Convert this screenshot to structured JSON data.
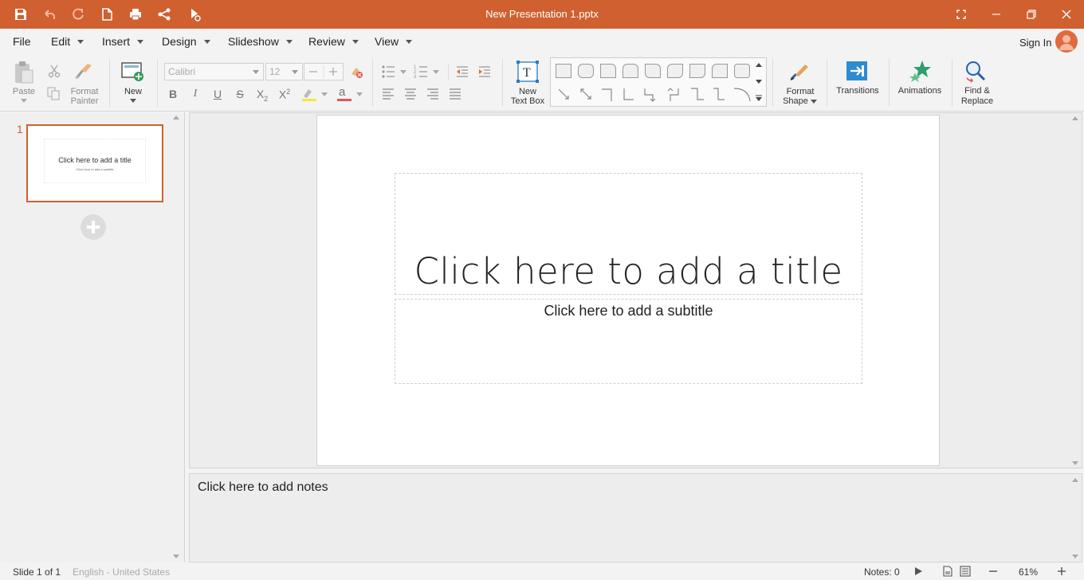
{
  "titlebar": {
    "document_title": "New Presentation 1.pptx",
    "quick_access": [
      "save-icon",
      "undo-icon",
      "redo-icon",
      "new-document-icon",
      "print-icon",
      "share-icon",
      "slideshow-from-start-icon"
    ],
    "window_controls": [
      "fullscreen-icon",
      "minimize-icon",
      "restore-icon",
      "close-icon"
    ]
  },
  "menu": {
    "file": "File",
    "edit": "Edit",
    "insert": "Insert",
    "design": "Design",
    "slideshow": "Slideshow",
    "review": "Review",
    "view": "View",
    "sign_in": "Sign In"
  },
  "ribbon": {
    "paste": "Paste",
    "format_painter_line1": "Format",
    "format_painter_line2": "Painter",
    "new": "New",
    "font_name": "Calibri",
    "font_size": "12",
    "new_text_box_line1": "New",
    "new_text_box_line2": "Text Box",
    "format_shape_line1": "Format",
    "format_shape_line2": "Shape",
    "transitions": "Transitions",
    "animations": "Animations",
    "find_replace_line1": "Find &",
    "find_replace_line2": "Replace"
  },
  "slides_panel": {
    "slide_number": "1",
    "thumb_title": "Click here to add a title",
    "thumb_subtitle": "Click here to add a subtitle"
  },
  "slide": {
    "title_placeholder": "Click here to add a title",
    "subtitle_placeholder": "Click here to add a subtitle"
  },
  "notes": {
    "placeholder": "Click here to add notes"
  },
  "status": {
    "slide_info": "Slide 1 of 1",
    "language": "English - United States",
    "notes_count": "Notes: 0",
    "zoom": "61%"
  },
  "colors": {
    "accent": "#d0602f",
    "background": "#f3f3f3",
    "slide": "#ffffff"
  }
}
